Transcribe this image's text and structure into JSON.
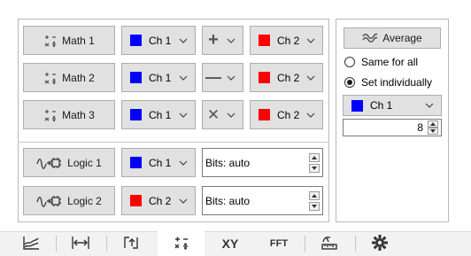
{
  "colors": {
    "ch1": "#0000ff",
    "ch2": "#ff0000"
  },
  "math_rows": [
    {
      "button": "Math 1",
      "icon": "math-icon",
      "ch_a": "Ch 1",
      "ch_a_color": "blue",
      "operator": "+",
      "ch_b": "Ch 2",
      "ch_b_color": "red"
    },
    {
      "button": "Math 2",
      "icon": "math-icon",
      "ch_a": "Ch 1",
      "ch_a_color": "blue",
      "operator": "—",
      "ch_b": "Ch 2",
      "ch_b_color": "red"
    },
    {
      "button": "Math 3",
      "icon": "math-icon",
      "ch_a": "Ch 1",
      "ch_a_color": "blue",
      "operator": "✕",
      "ch_b": "Ch 2",
      "ch_b_color": "red"
    }
  ],
  "logic_rows": [
    {
      "button": "Logic 1",
      "icon": "logic-analyzer-icon",
      "channel": "Ch 1",
      "channel_color": "blue",
      "bits": "Bits: auto"
    },
    {
      "button": "Logic 2",
      "icon": "logic-analyzer-icon",
      "channel": "Ch 2",
      "channel_color": "red",
      "bits": "Bits: auto"
    }
  ],
  "average": {
    "button": "Average",
    "icon": "average-wave-icon",
    "options": [
      "Same for all",
      "Set individually"
    ],
    "selected_option": "Set individually",
    "channel": "Ch 1",
    "channel_color": "blue",
    "count": "8"
  },
  "tabs": [
    {
      "name": "spectrum",
      "icon": "spectrum-icon",
      "label": ""
    },
    {
      "name": "cursors",
      "icon": "horizontal-cursors-icon",
      "label": ""
    },
    {
      "name": "trigger",
      "icon": "trigger-icon",
      "label": ""
    },
    {
      "name": "math",
      "icon": "math-icon",
      "label": "",
      "active": true
    },
    {
      "name": "xy",
      "icon": "",
      "label": "XY"
    },
    {
      "name": "fft",
      "icon": "",
      "label": "FFT"
    },
    {
      "name": "measure",
      "icon": "measure-icon",
      "label": ""
    },
    {
      "name": "settings",
      "icon": "gear-icon",
      "label": ""
    }
  ]
}
